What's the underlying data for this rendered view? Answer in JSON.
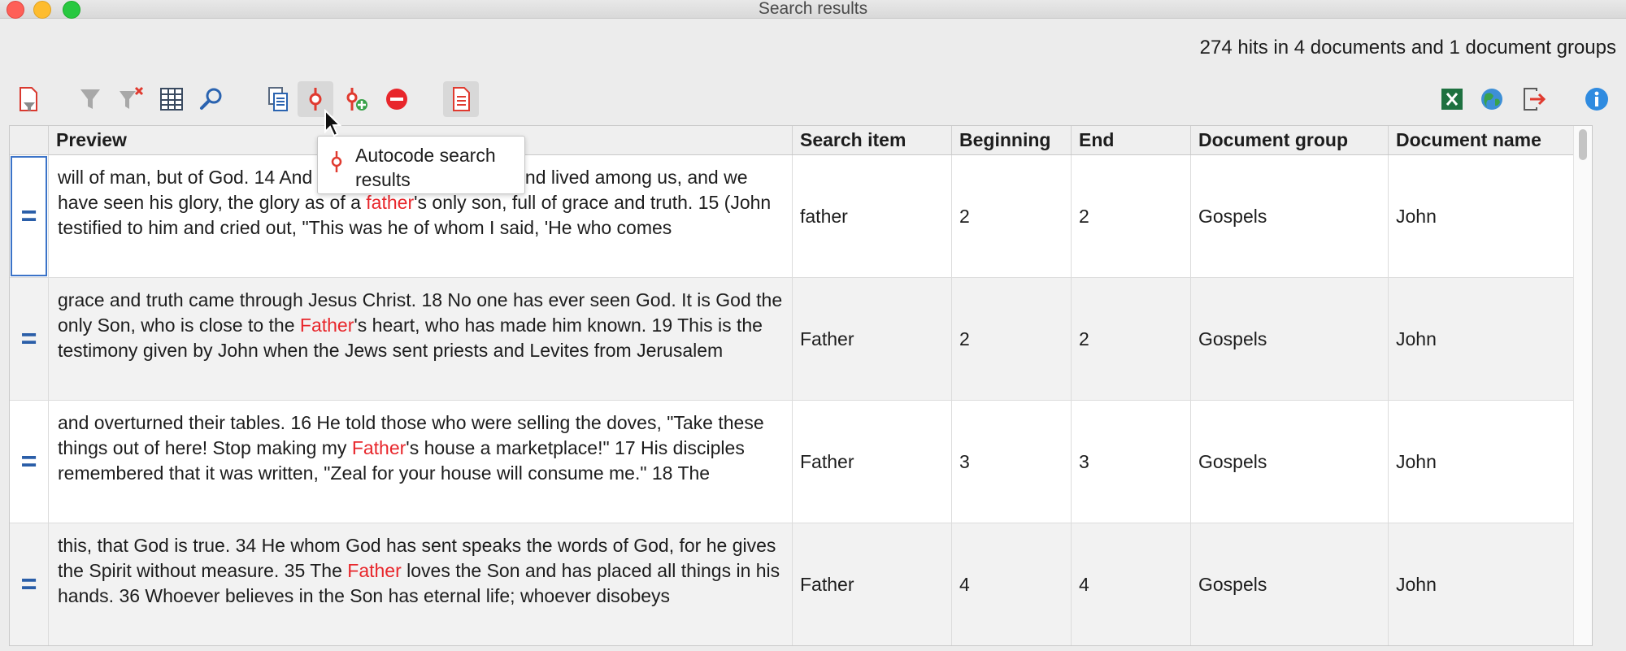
{
  "window": {
    "title": "Search results"
  },
  "summary": {
    "hits": "274 hits in 4 documents and 1 document groups"
  },
  "toolbar": {
    "left_icons": [
      "filter-document-icon",
      "filter-icon",
      "clear-filter-icon",
      "columns-icon",
      "search-icon",
      "document-list-icon",
      "autocode-icon",
      "autocode-add-icon",
      "delete-icon",
      "report-icon"
    ],
    "right_icons": [
      "excel-export-icon",
      "web-export-icon",
      "export-icon",
      "info-icon"
    ],
    "active": "autocode-icon"
  },
  "tooltip": {
    "text": "Autocode search results"
  },
  "table": {
    "columns": [
      "Preview",
      "Search item",
      "Beginning",
      "End",
      "Document group",
      "Document name"
    ],
    "rows": [
      {
        "pre": " will of man, but of God. 14 And the Word became flesh and lived among us, and we have seen his glory, the glory as of a ",
        "hit": "father",
        "post": "'s only son, full of grace and truth. 15 (John testified to him and cried out, \"This was he of whom I said, 'He who comes",
        "search_item": "father",
        "beginning": "2",
        "end": "2",
        "group": "Gospels",
        "doc": "John"
      },
      {
        "pre": " grace and truth came through Jesus Christ. 18 No one has ever seen God. It is God the only Son, who is close to the ",
        "hit": "Father",
        "post": "'s heart, who has made him known. 19 This is the testimony given by John when the Jews sent priests and Levites from Jerusalem",
        "search_item": "Father",
        "beginning": "2",
        "end": "2",
        "group": "Gospels",
        "doc": "John"
      },
      {
        "pre": " and overturned their tables. 16 He told those who were selling the doves, \"Take these things out of here! Stop making my ",
        "hit": "Father",
        "post": "'s house a marketplace!\" 17 His disciples remembered that it was written, \"Zeal for your house will consume me.\" 18 The",
        "search_item": "Father",
        "beginning": "3",
        "end": "3",
        "group": "Gospels",
        "doc": "John"
      },
      {
        "pre": " this, that God is true. 34 He whom God has sent speaks the words of God, for he gives the Spirit without measure. 35 The ",
        "hit": "Father",
        "post": " loves the Son and has placed all things in his hands. 36 Whoever believes in the Son has eternal life; whoever disobeys",
        "search_item": "Father",
        "beginning": "4",
        "end": "4",
        "group": "Gospels",
        "doc": "John"
      }
    ],
    "row_marker": "=",
    "highlight_color": "#e8262b"
  }
}
